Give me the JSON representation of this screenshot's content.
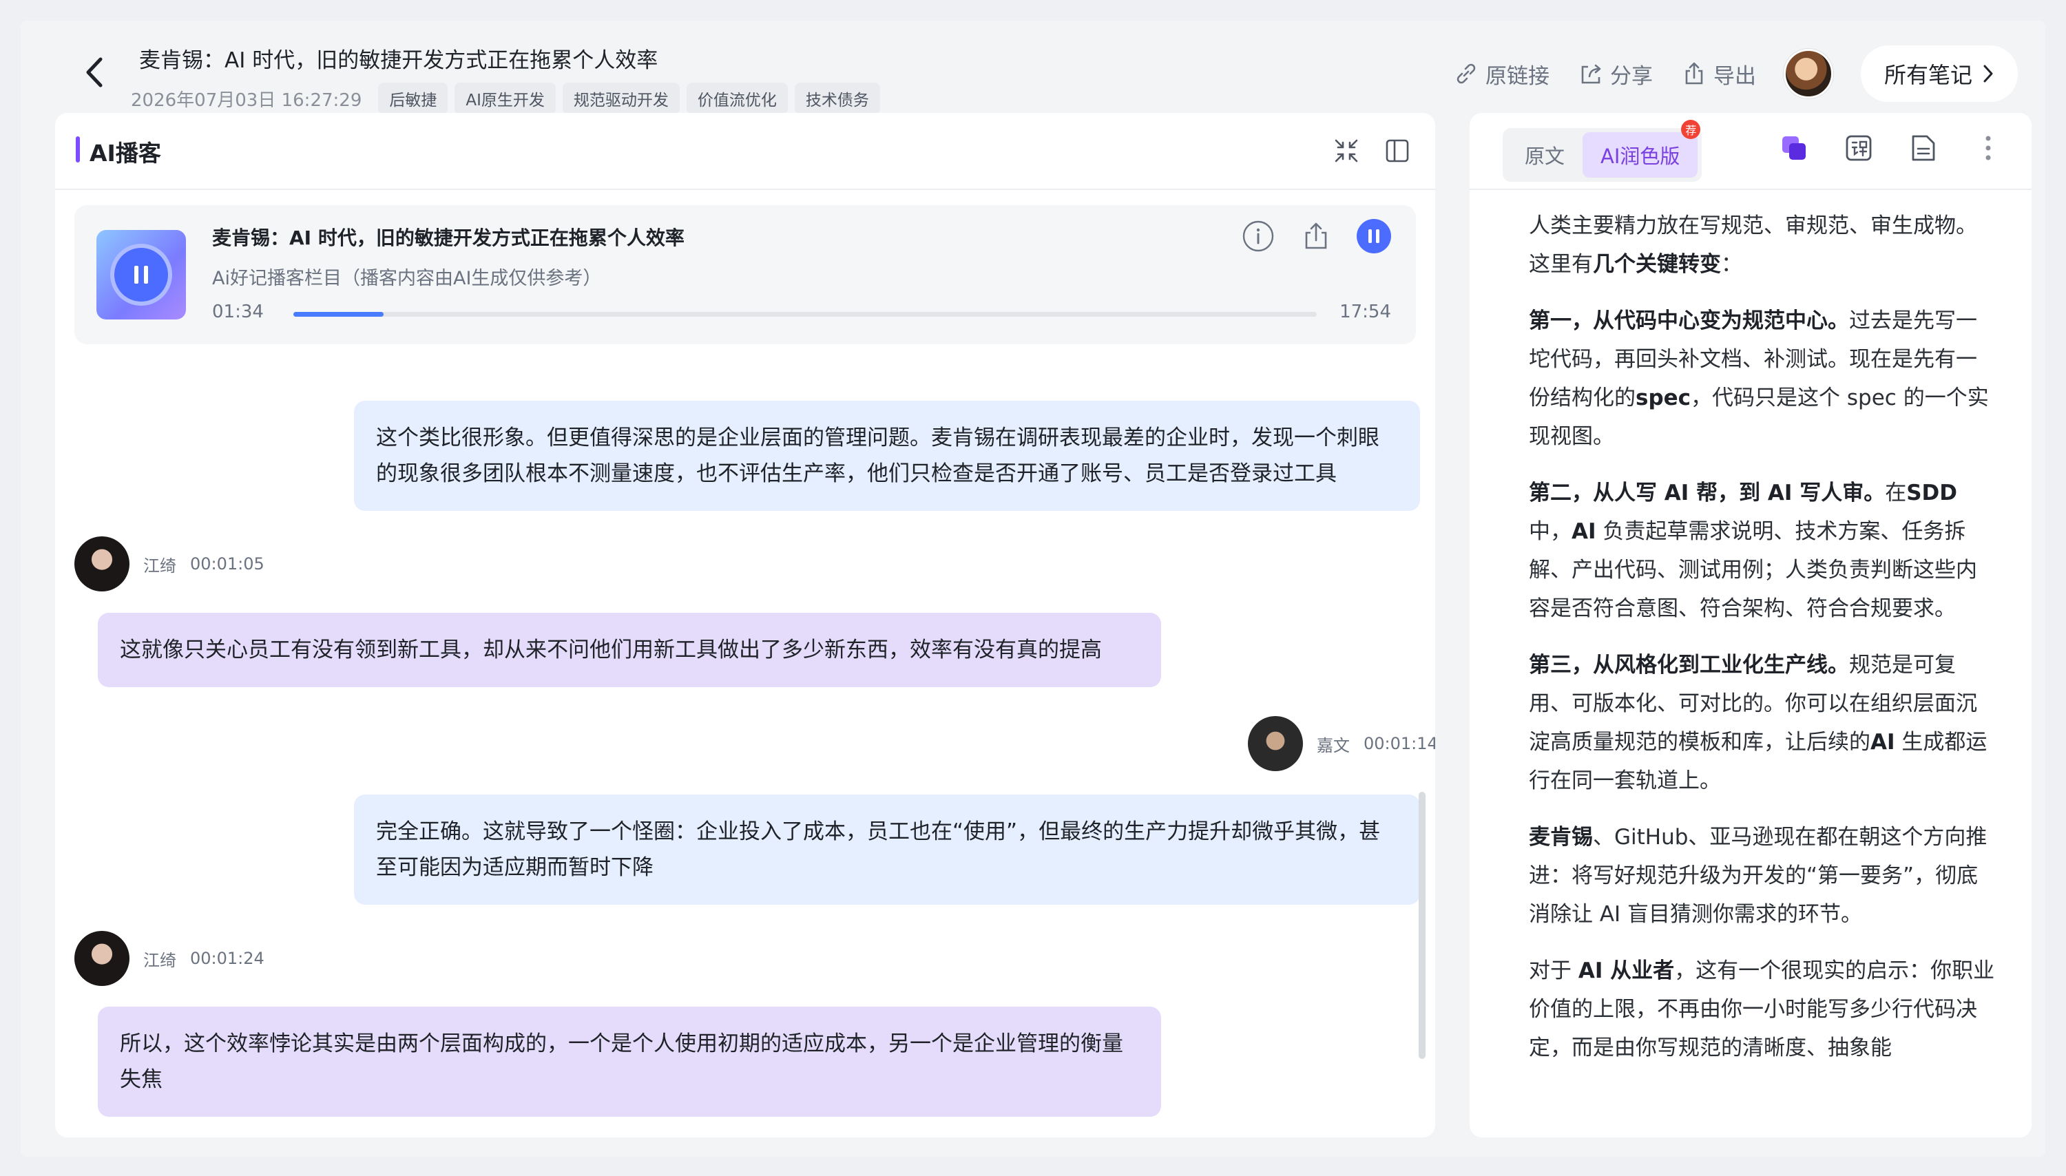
{
  "header": {
    "title": "麦肯锡：AI 时代，旧的敏捷开发方式正在拖累个人效率",
    "date": "2026年07月03日 16:27:29",
    "tags": [
      "后敏捷",
      "AI原生开发",
      "规范驱动开发",
      "价值流优化",
      "技术债务"
    ],
    "actions": {
      "link": "原链接",
      "share": "分享",
      "export": "导出"
    },
    "all_notes": "所有笔记"
  },
  "podcast": {
    "panel_title": "AI播客",
    "title": "麦肯锡：AI 时代，旧的敏捷开发方式正在拖累个人效率",
    "subtitle": "Ai好记播客栏目（播客内容由AI生成仅供参考）",
    "current_time": "01:34",
    "total_time": "17:54",
    "progress_fraction": 0.088
  },
  "transcript": [
    {
      "text": "这个类比很形象。但更值得深思的是企业层面的管理问题。麦肯锡在调研表现最差的企业时，发现一个刺眼的现象很多团队根本不测量速度，也不评估生产率，他们只检查是否开通了账号、员工是否登录过工具"
    },
    {
      "speaker": "江绮",
      "time": "00:01:05",
      "text": "这就像只关心员工有没有领到新工具，却从来不问他们用新工具做出了多少新东西，效率有没有真的提高"
    },
    {
      "speaker": "嘉文",
      "time": "00:01:14",
      "text": "完全正确。这就导致了一个怪圈：企业投入了成本，员工也在“使用”，但最终的生产力提升却微乎其微，甚至可能因为适应期而暂时下降"
    },
    {
      "speaker": "江绮",
      "time": "00:01:24",
      "text": "所以，这个效率悖论其实是由两个层面构成的，一个是个人使用初期的适应成本，另一个是企业管理的衡量失焦"
    }
  ],
  "right": {
    "tab_original": "原文",
    "tab_ai": "AI润色版",
    "badge": "荐",
    "paragraphs": [
      [
        {
          "t": "人类主要精力放在写规范、审规范、审生成物。这里有"
        },
        {
          "t": "几个关键转变",
          "b": true
        },
        {
          "t": "："
        }
      ],
      [
        {
          "t": "第一，从代码中心变为规范中心。",
          "b": true
        },
        {
          "t": "过去是先写一坨代码，再回头补文档、补测试。现在是先有一份结构化的"
        },
        {
          "t": "spec",
          "b": true
        },
        {
          "t": "，代码只是这个 spec 的一个实现视图。"
        }
      ],
      [
        {
          "t": "第二，从人写 AI 帮，到 AI 写人审。",
          "b": true
        },
        {
          "t": "在"
        },
        {
          "t": "SDD",
          "b": true
        },
        {
          "t": "中，"
        },
        {
          "t": "AI",
          "b": true
        },
        {
          "t": " 负责起草需求说明、技术方案、任务拆解、产出代码、测试用例；人类负责判断这些内容是否符合意图、符合架构、符合合规要求。"
        }
      ],
      [
        {
          "t": "第三，从风格化到工业化生产线。",
          "b": true
        },
        {
          "t": "规范是可复用、可版本化、可对比的。你可以在组织层面沉淀高质量规范的模板和库，让后续的"
        },
        {
          "t": "AI",
          "b": true
        },
        {
          "t": " 生成都运行在同一套轨道上。"
        }
      ],
      [
        {
          "t": "麦肯锡",
          "b": true
        },
        {
          "t": "、GitHub、亚马逊现在都在朝这个方向推进：将写好规范升级为开发的“第一要务”，彻底消除让 AI 盲目猜测你需求的环节。"
        }
      ],
      [
        {
          "t": "对于 "
        },
        {
          "t": "AI 从业者",
          "b": true
        },
        {
          "t": "，这有一个很现实的启示：你职业价值的上限，不再由你一小时能写多少行代码决定，而是由你写规范的清晰度、抽象能"
        }
      ]
    ]
  },
  "colors": {
    "accent": "#7c4dff",
    "blue_bubble": "#e6efff",
    "purple_bubble": "#e4dcfa",
    "player_blue": "#4c6bff"
  }
}
